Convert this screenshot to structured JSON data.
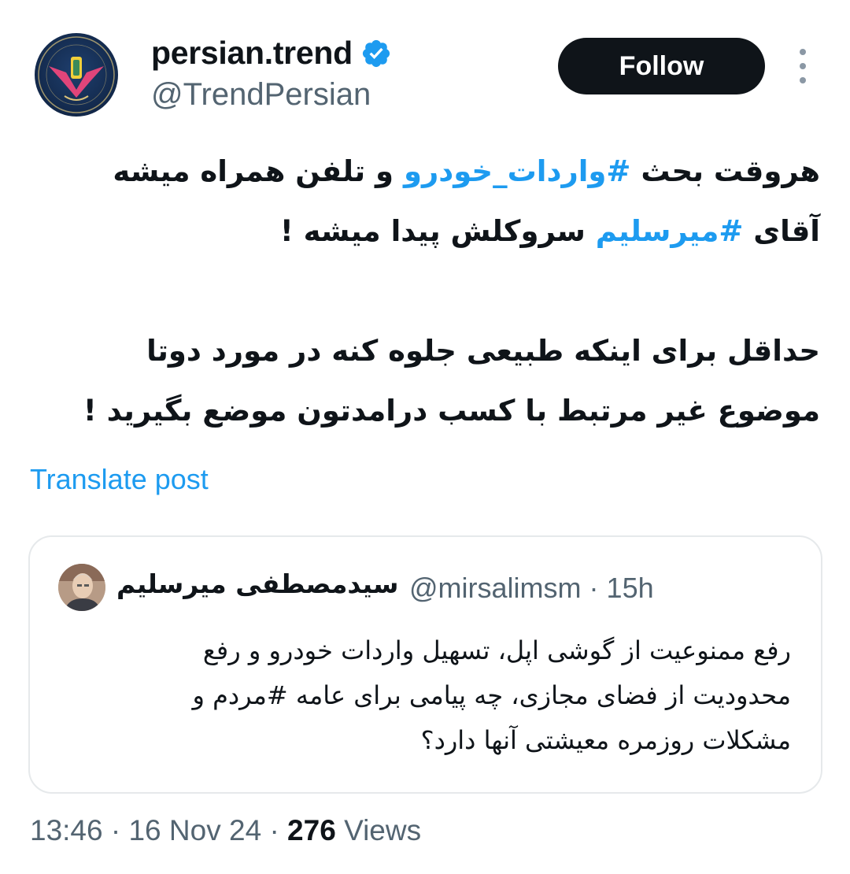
{
  "author": {
    "display_name": "persian.trend",
    "handle": "@TrendPersian",
    "verified": true,
    "avatar_icon": "persian-trend-logo"
  },
  "follow_label": "Follow",
  "more_icon": "more-vertical-icon",
  "tweet": {
    "line1": {
      "before": "هروقت بحث ",
      "hashtag": "#واردات_خودرو",
      "after": " و تلفن همراه میشه"
    },
    "line2": {
      "before": "آقای ",
      "hashtag": "#میرسلیم",
      "after": " سروکلش پیدا میشه !"
    },
    "line3": "حداقل برای اینکه طبیعی جلوه کنه در مورد دوتا",
    "line4": "موضوع غیر مرتبط با کسب درامدتون موضع بگیرید !"
  },
  "translate_label": "Translate post",
  "quoted": {
    "name": "سیدمصطفی میرسلیم",
    "handle": "@mirsalimsm",
    "separator": "·",
    "time": "15h",
    "lines": [
      "رفع ممنوعیت از گوشی اپل، تسهیل واردات خودرو و رفع",
      "محدودیت از فضای مجازی، چه پیامی برای عامه #مردم و",
      "مشکلات روزمره معیشتی آنها دارد؟"
    ]
  },
  "meta": {
    "time": "13:46",
    "date": "16 Nov 24",
    "separator": "·",
    "views_count": "276",
    "views_label": "Views"
  },
  "colors": {
    "accent": "#1d9bf0",
    "text": "#0f1419",
    "muted": "#536471",
    "follow_bg": "#0f1419"
  }
}
